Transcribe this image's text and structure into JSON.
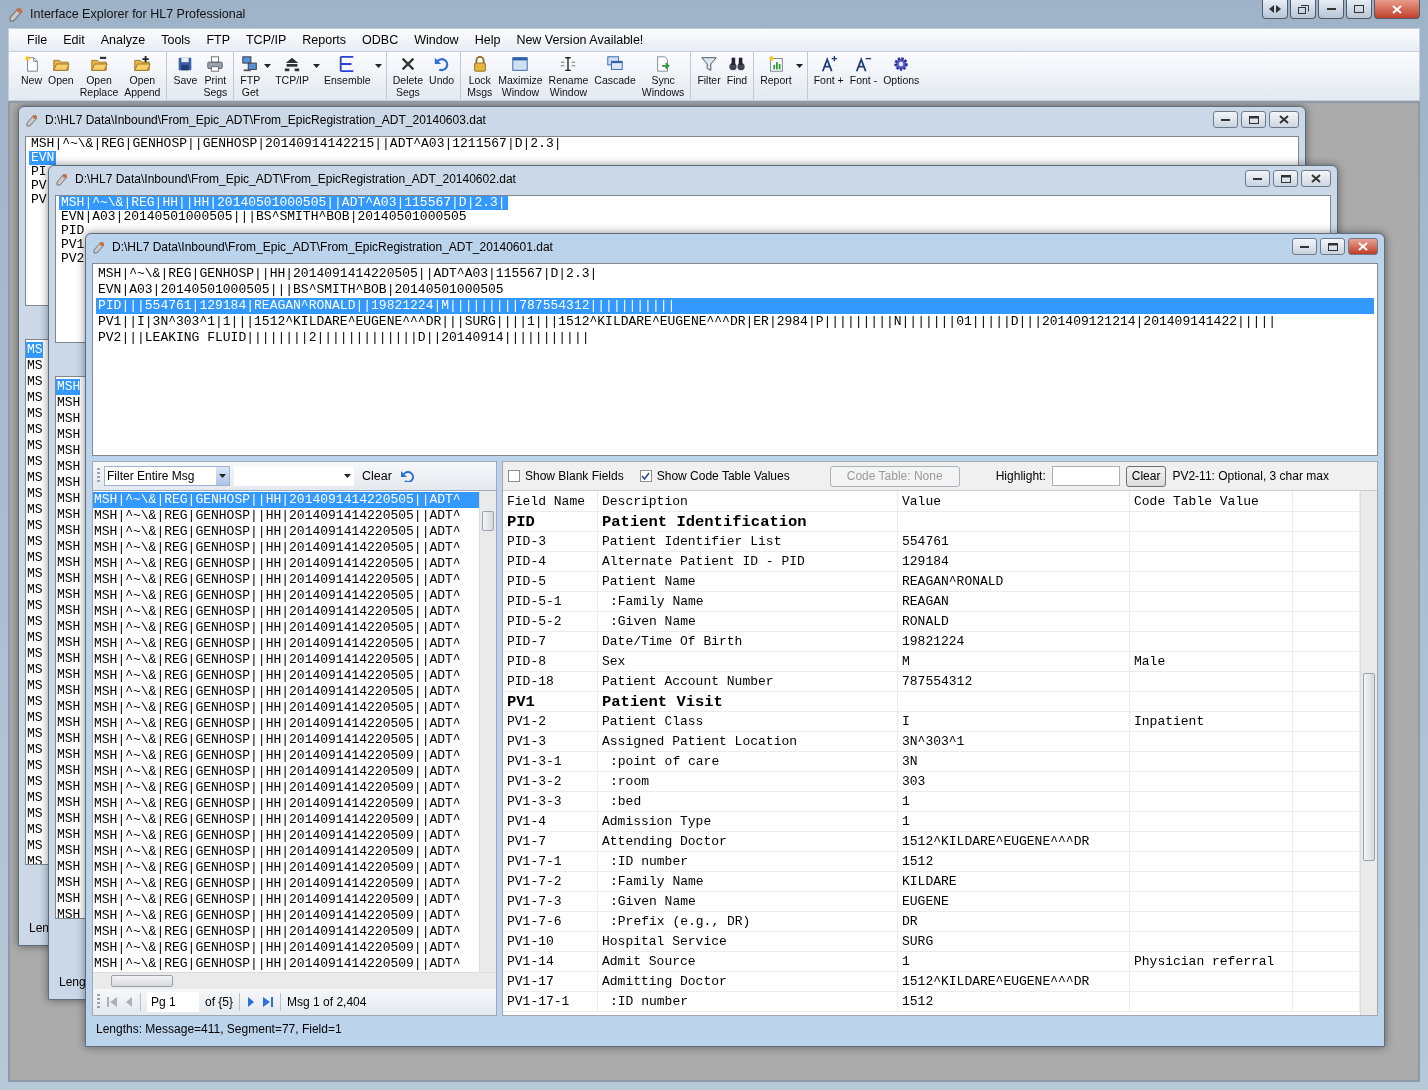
{
  "app": {
    "title": "Interface Explorer for HL7 Professional"
  },
  "menu": [
    "File",
    "Edit",
    "Analyze",
    "Tools",
    "FTP",
    "TCP/IP",
    "Reports",
    "ODBC",
    "Window",
    "Help",
    "New Version Available!"
  ],
  "toolbar": [
    [
      {
        "label": "New",
        "kind": "new",
        "dropdown": false
      },
      {
        "label": "Open",
        "kind": "open",
        "dropdown": false
      },
      {
        "label": "Open\nReplace",
        "kind": "open-replace",
        "dropdown": false
      },
      {
        "label": "Open\nAppend",
        "kind": "open-append",
        "dropdown": false
      }
    ],
    [
      {
        "label": "Save",
        "kind": "save",
        "dropdown": false
      },
      {
        "label": "Print\nSegs",
        "kind": "print",
        "dropdown": false
      }
    ],
    [
      {
        "label": "FTP\nGet",
        "kind": "ftp",
        "dropdown": true
      },
      {
        "label": "TCP/IP",
        "kind": "network",
        "dropdown": true
      },
      {
        "label": "Ensemble",
        "kind": "ensemble",
        "dropdown": true
      }
    ],
    [
      {
        "label": "Delete\nSegs",
        "kind": "delete",
        "dropdown": false
      },
      {
        "label": "Undo",
        "kind": "undo",
        "dropdown": false
      }
    ],
    [
      {
        "label": "Lock\nMsgs",
        "kind": "lock",
        "dropdown": false
      },
      {
        "label": "Maximize\nWindow",
        "kind": "maximize",
        "dropdown": false
      },
      {
        "label": "Rename\nWindow",
        "kind": "rename",
        "dropdown": false
      },
      {
        "label": "Cascade",
        "kind": "cascade",
        "dropdown": false
      },
      {
        "label": "Sync\nWindows",
        "kind": "sync",
        "dropdown": false
      }
    ],
    [
      {
        "label": "Filter",
        "kind": "filter",
        "dropdown": false
      },
      {
        "label": "Find",
        "kind": "find",
        "dropdown": false
      }
    ],
    [
      {
        "label": "Report",
        "kind": "report",
        "dropdown": true
      }
    ],
    [
      {
        "label": "Font +",
        "kind": "font-plus",
        "dropdown": false
      },
      {
        "label": "Font -",
        "kind": "font-minus",
        "dropdown": false
      },
      {
        "label": "Options",
        "kind": "options",
        "dropdown": false
      }
    ]
  ],
  "windows": [
    {
      "title": "D:\\HL7 Data\\Inbound\\From_Epic_ADT\\From_EpicRegistration_ADT_20140603.dat",
      "segments": [
        {
          "text": "MSH|^~\\&|REG|GENHOSP||GENHOSP|20140914142215||ADT^A03|1211567|D|2.3|",
          "selected": false
        },
        {
          "text": "EVN",
          "selected": true
        },
        {
          "text": "PI",
          "selected": false
        },
        {
          "text": "PV",
          "selected": false
        },
        {
          "text": "PV",
          "selected": false
        }
      ],
      "message_list": [
        {
          "text": "MS",
          "selected": true
        },
        {
          "text": "MS",
          "selected": false
        },
        {
          "text": "MS",
          "selected": false
        },
        {
          "text": "MS",
          "selected": false
        },
        {
          "text": "MS",
          "selected": false
        },
        {
          "text": "MS",
          "selected": false
        },
        {
          "text": "MS",
          "selected": false
        },
        {
          "text": "MS",
          "selected": false
        },
        {
          "text": "MS",
          "selected": false
        },
        {
          "text": "MS",
          "selected": false
        },
        {
          "text": "MS",
          "selected": false
        },
        {
          "text": "MS",
          "selected": false
        },
        {
          "text": "MS",
          "selected": false
        },
        {
          "text": "MS",
          "selected": false
        },
        {
          "text": "MS",
          "selected": false
        },
        {
          "text": "MS",
          "selected": false
        },
        {
          "text": "MS",
          "selected": false
        },
        {
          "text": "MS",
          "selected": false
        },
        {
          "text": "MS",
          "selected": false
        },
        {
          "text": "MS",
          "selected": false
        },
        {
          "text": "MS",
          "selected": false
        },
        {
          "text": "MS",
          "selected": false
        },
        {
          "text": "MS",
          "selected": false
        },
        {
          "text": "MS",
          "selected": false
        },
        {
          "text": "MS",
          "selected": false
        },
        {
          "text": "MS",
          "selected": false
        },
        {
          "text": "MS",
          "selected": false
        },
        {
          "text": "MS",
          "selected": false
        },
        {
          "text": "MS",
          "selected": false
        },
        {
          "text": "MS",
          "selected": false
        },
        {
          "text": "MS",
          "selected": false
        },
        {
          "text": "MS",
          "selected": false
        },
        {
          "text": "MS",
          "selected": false
        }
      ],
      "status": "Len"
    },
    {
      "title": "D:\\HL7 Data\\Inbound\\From_Epic_ADT\\From_EpicRegistration_ADT_20140602.dat",
      "segments": [
        {
          "text": "MSH|^~\\&|REG|HH||HH|20140501000505||ADT^A03|115567|D|2.3|",
          "selected": true
        },
        {
          "text": "EVN|A03|20140501000505|||BS^SMITH^BOB|20140501000505",
          "selected": false
        },
        {
          "text": "PID",
          "selected": false
        },
        {
          "text": "PV1",
          "selected": false
        },
        {
          "text": "PV2",
          "selected": false
        }
      ],
      "message_list": [
        {
          "text": "MSH",
          "selected": true
        },
        {
          "text": "MSH",
          "selected": false
        },
        {
          "text": "MSH",
          "selected": false
        },
        {
          "text": "MSH",
          "selected": false
        },
        {
          "text": "MSH",
          "selected": false
        },
        {
          "text": "MSH",
          "selected": false
        },
        {
          "text": "MSH",
          "selected": false
        },
        {
          "text": "MSH",
          "selected": false
        },
        {
          "text": "MSH",
          "selected": false
        },
        {
          "text": "MSH",
          "selected": false
        },
        {
          "text": "MSH",
          "selected": false
        },
        {
          "text": "MSH",
          "selected": false
        },
        {
          "text": "MSH",
          "selected": false
        },
        {
          "text": "MSH",
          "selected": false
        },
        {
          "text": "MSH",
          "selected": false
        },
        {
          "text": "MSH",
          "selected": false
        },
        {
          "text": "MSH",
          "selected": false
        },
        {
          "text": "MSH",
          "selected": false
        },
        {
          "text": "MSH",
          "selected": false
        },
        {
          "text": "MSH",
          "selected": false
        },
        {
          "text": "MSH",
          "selected": false
        },
        {
          "text": "MSH",
          "selected": false
        },
        {
          "text": "MSH",
          "selected": false
        },
        {
          "text": "MSH",
          "selected": false
        },
        {
          "text": "MSH",
          "selected": false
        },
        {
          "text": "MSH",
          "selected": false
        },
        {
          "text": "MSH",
          "selected": false
        },
        {
          "text": "MSH",
          "selected": false
        },
        {
          "text": "MSH",
          "selected": false
        },
        {
          "text": "MSH",
          "selected": false
        },
        {
          "text": "MSH",
          "selected": false
        },
        {
          "text": "MSH",
          "selected": false
        },
        {
          "text": "MSH",
          "selected": false
        },
        {
          "text": "MSH",
          "selected": false
        }
      ],
      "status": "Leng"
    },
    {
      "title": "D:\\HL7 Data\\Inbound\\From_Epic_ADT\\From_EpicRegistration_ADT_20140601.dat",
      "segments": [
        {
          "text": "MSH|^~\\&|REG|GENHOSP||HH|2014091414220505||ADT^A03|115567|D|2.3|",
          "selected": false
        },
        {
          "text": "EVN|A03|20140501000505|||BS^SMITH^BOB|20140501000505",
          "selected": false
        },
        {
          "text": "PID|||554761|129184|REAGAN^RONALD||19821224|M|||||||||787554312|||||||||||",
          "selected": true
        },
        {
          "text": "PV1||I|3N^303^1|1|||1512^KILDARE^EUGENE^^^DR|||SURG||||1|||1512^KILDARE^EUGENE^^^DR|ER|2984|P|||||||||N|||||||01|||||D|||201409121214|201409141422|||||",
          "selected": false
        },
        {
          "text": "PV2|||LEAKING FLUID||||||||2|||||||||||||D||20140914|||||||||||",
          "selected": false
        }
      ],
      "filter": {
        "scope": "Filter Entire Msg",
        "clear": "Clear"
      },
      "message_list": [
        {
          "text": "MSH|^~\\&|REG|GENHOSP||HH|2014091414220505||ADT^",
          "selected": true
        },
        {
          "text": "MSH|^~\\&|REG|GENHOSP||HH|2014091414220505||ADT^",
          "selected": false
        },
        {
          "text": "MSH|^~\\&|REG|GENHOSP||HH|2014091414220505||ADT^",
          "selected": false
        },
        {
          "text": "MSH|^~\\&|REG|GENHOSP||HH|2014091414220505||ADT^",
          "selected": false
        },
        {
          "text": "MSH|^~\\&|REG|GENHOSP||HH|2014091414220505||ADT^",
          "selected": false
        },
        {
          "text": "MSH|^~\\&|REG|GENHOSP||HH|2014091414220505||ADT^",
          "selected": false
        },
        {
          "text": "MSH|^~\\&|REG|GENHOSP||HH|2014091414220505||ADT^",
          "selected": false
        },
        {
          "text": "MSH|^~\\&|REG|GENHOSP||HH|2014091414220505||ADT^",
          "selected": false
        },
        {
          "text": "MSH|^~\\&|REG|GENHOSP||HH|2014091414220505||ADT^",
          "selected": false
        },
        {
          "text": "MSH|^~\\&|REG|GENHOSP||HH|2014091414220505||ADT^",
          "selected": false
        },
        {
          "text": "MSH|^~\\&|REG|GENHOSP||HH|2014091414220505||ADT^",
          "selected": false
        },
        {
          "text": "MSH|^~\\&|REG|GENHOSP||HH|2014091414220505||ADT^",
          "selected": false
        },
        {
          "text": "MSH|^~\\&|REG|GENHOSP||HH|2014091414220505||ADT^",
          "selected": false
        },
        {
          "text": "MSH|^~\\&|REG|GENHOSP||HH|2014091414220505||ADT^",
          "selected": false
        },
        {
          "text": "MSH|^~\\&|REG|GENHOSP||HH|2014091414220505||ADT^",
          "selected": false
        },
        {
          "text": "MSH|^~\\&|REG|GENHOSP||HH|2014091414220505||ADT^",
          "selected": false
        },
        {
          "text": "MSH|^~\\&|REG|GENHOSP||HH|2014091414220509||ADT^",
          "selected": false
        },
        {
          "text": "MSH|^~\\&|REG|GENHOSP||HH|2014091414220509||ADT^",
          "selected": false
        },
        {
          "text": "MSH|^~\\&|REG|GENHOSP||HH|2014091414220509||ADT^",
          "selected": false
        },
        {
          "text": "MSH|^~\\&|REG|GENHOSP||HH|2014091414220509||ADT^",
          "selected": false
        },
        {
          "text": "MSH|^~\\&|REG|GENHOSP||HH|2014091414220509||ADT^",
          "selected": false
        },
        {
          "text": "MSH|^~\\&|REG|GENHOSP||HH|2014091414220509||ADT^",
          "selected": false
        },
        {
          "text": "MSH|^~\\&|REG|GENHOSP||HH|2014091414220509||ADT^",
          "selected": false
        },
        {
          "text": "MSH|^~\\&|REG|GENHOSP||HH|2014091414220509||ADT^",
          "selected": false
        },
        {
          "text": "MSH|^~\\&|REG|GENHOSP||HH|2014091414220509||ADT^",
          "selected": false
        },
        {
          "text": "MSH|^~\\&|REG|GENHOSP||HH|2014091414220509||ADT^",
          "selected": false
        },
        {
          "text": "MSH|^~\\&|REG|GENHOSP||HH|2014091414220509||ADT^",
          "selected": false
        },
        {
          "text": "MSH|^~\\&|REG|GENHOSP||HH|2014091414220509||ADT^",
          "selected": false
        },
        {
          "text": "MSH|^~\\&|REG|GENHOSP||HH|2014091414220509||ADT^",
          "selected": false
        },
        {
          "text": "MSH|^~\\&|REG|GENHOSP||HH|2014091414220509||ADT^",
          "selected": false
        }
      ],
      "pager": {
        "page": "Pg 1",
        "of": "of {5}",
        "position": "Msg 1 of 2,404"
      },
      "options": {
        "checkboxes": [
          {
            "label": "Show Blank Fields",
            "checked": false
          },
          {
            "label": "Show Code Table Values",
            "checked": true
          }
        ],
        "code_table_button": {
          "label": "Code Table: None",
          "disabled": true
        },
        "highlight_label": "Highlight:",
        "highlight_clear": "Clear",
        "hint": "PV2-11: Optional, 3 char max"
      },
      "fields": {
        "columns": [
          "Field Name",
          "Description",
          "Value",
          "Code Table Value"
        ],
        "rows": [
          {
            "kind": "segment",
            "field": "PID",
            "description": "Patient Identification",
            "value": "",
            "code": ""
          },
          {
            "kind": "field",
            "field": "PID-3",
            "description": "Patient Identifier List",
            "value": "554761",
            "code": ""
          },
          {
            "kind": "field",
            "field": "PID-4",
            "description": "Alternate Patient ID - PID",
            "value": "129184",
            "code": ""
          },
          {
            "kind": "field",
            "field": "PID-5",
            "description": "Patient Name",
            "value": "REAGAN^RONALD",
            "code": ""
          },
          {
            "kind": "subfield",
            "field": "PID-5-1",
            "description": ":Family Name",
            "value": "REAGAN",
            "code": ""
          },
          {
            "kind": "subfield",
            "field": "PID-5-2",
            "description": ":Given Name",
            "value": "RONALD",
            "code": ""
          },
          {
            "kind": "field",
            "field": "PID-7",
            "description": "Date/Time Of Birth",
            "value": "19821224",
            "code": ""
          },
          {
            "kind": "field",
            "field": "PID-8",
            "description": "Sex",
            "value": "M",
            "code": "Male"
          },
          {
            "kind": "field",
            "field": "PID-18",
            "description": "Patient Account Number",
            "value": "787554312",
            "code": ""
          },
          {
            "kind": "segment",
            "field": "PV1",
            "description": "Patient Visit",
            "value": "",
            "code": ""
          },
          {
            "kind": "field",
            "field": "PV1-2",
            "description": "Patient Class",
            "value": "I",
            "code": "Inpatient"
          },
          {
            "kind": "field",
            "field": "PV1-3",
            "description": "Assigned Patient Location",
            "value": "3N^303^1",
            "code": ""
          },
          {
            "kind": "subfield",
            "field": "PV1-3-1",
            "description": ":point of care",
            "value": "3N",
            "code": ""
          },
          {
            "kind": "subfield",
            "field": "PV1-3-2",
            "description": ":room",
            "value": "303",
            "code": ""
          },
          {
            "kind": "subfield",
            "field": "PV1-3-3",
            "description": ":bed",
            "value": "1",
            "code": ""
          },
          {
            "kind": "field",
            "field": "PV1-4",
            "description": "Admission Type",
            "value": "1",
            "code": ""
          },
          {
            "kind": "field",
            "field": "PV1-7",
            "description": "Attending Doctor",
            "value": "1512^KILDARE^EUGENE^^^DR",
            "code": ""
          },
          {
            "kind": "subfield",
            "field": "PV1-7-1",
            "description": ":ID number",
            "value": "1512",
            "code": ""
          },
          {
            "kind": "subfield",
            "field": "PV1-7-2",
            "description": ":Family Name",
            "value": "KILDARE",
            "code": ""
          },
          {
            "kind": "subfield",
            "field": "PV1-7-3",
            "description": ":Given Name",
            "value": "EUGENE",
            "code": ""
          },
          {
            "kind": "subfield",
            "field": "PV1-7-6",
            "description": ":Prefix (e.g., DR)",
            "value": "DR",
            "code": ""
          },
          {
            "kind": "field",
            "field": "PV1-10",
            "description": "Hospital Service",
            "value": "SURG",
            "code": ""
          },
          {
            "kind": "field",
            "field": "PV1-14",
            "description": "Admit Source",
            "value": "1",
            "code": "Physician referral"
          },
          {
            "kind": "field",
            "field": "PV1-17",
            "description": "Admitting Doctor",
            "value": "1512^KILDARE^EUGENE^^^DR",
            "code": ""
          },
          {
            "kind": "subfield",
            "field": "PV1-17-1",
            "description": ":ID number",
            "value": "1512",
            "code": ""
          }
        ]
      },
      "status": "Lengths:  Message=411, Segment=77, Field=1"
    }
  ]
}
